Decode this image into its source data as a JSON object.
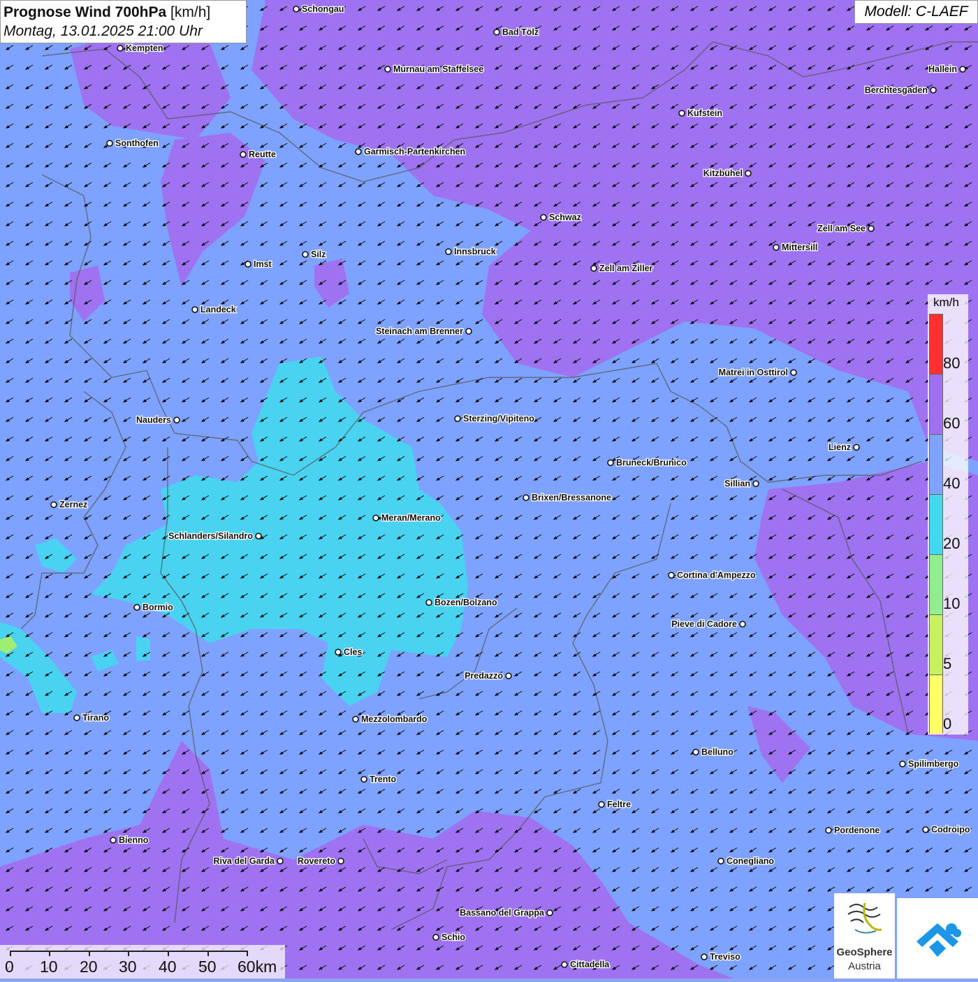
{
  "title": {
    "main": "Prognose Wind 700hPa",
    "unit": "[km/h]",
    "datetime": "Montag, 13.01.2025 21:00 Uhr"
  },
  "model_label": "Modell: C-LAEF",
  "colors": {
    "range_0_5": "#ffff66",
    "range_5_10": "#c8f060",
    "range_10_20": "#90ee90",
    "range_20_40": "#44d8f0",
    "range_40_60": "#7ea2ff",
    "range_60_80": "#a070f0",
    "range_80_plus": "#ff3030",
    "arrow": "#000000",
    "borders": "#555555"
  },
  "legend": {
    "unit": "km/h",
    "ticks": [
      "80",
      "60",
      "40",
      "20",
      "10",
      "5",
      "0"
    ]
  },
  "wind_arrows": {
    "direction": "from northeast toward southwest",
    "spacing_note": "uniform grid"
  },
  "scale_bar": {
    "labels": [
      "0",
      "10",
      "20",
      "30",
      "40",
      "50",
      "60km"
    ]
  },
  "cities": [
    {
      "name": "Schongau"
    },
    {
      "name": "Kempten"
    },
    {
      "name": "Bad Tölz"
    },
    {
      "name": "Murnau am Staffelsee"
    },
    {
      "name": "Hallein"
    },
    {
      "name": "Berchtesgaden"
    },
    {
      "name": "Kufstein"
    },
    {
      "name": "Sonthofen"
    },
    {
      "name": "Reutte"
    },
    {
      "name": "Garmisch-Partenkirchen"
    },
    {
      "name": "Kitzbühel"
    },
    {
      "name": "Schwaz"
    },
    {
      "name": "Zell am See"
    },
    {
      "name": "Mittersill"
    },
    {
      "name": "Innsbruck"
    },
    {
      "name": "Imst"
    },
    {
      "name": "Silz"
    },
    {
      "name": "Zell am Ziller"
    },
    {
      "name": "Landeck"
    },
    {
      "name": "Steinach am Brenner"
    },
    {
      "name": "Matrei in Osttirol"
    },
    {
      "name": "Nauders"
    },
    {
      "name": "Sterzing/Vipiteno"
    },
    {
      "name": "Lienz"
    },
    {
      "name": "Bruneck/Brunico"
    },
    {
      "name": "Sillian"
    },
    {
      "name": "Zernez"
    },
    {
      "name": "Brixen/Bressanone"
    },
    {
      "name": "Meran/Merano"
    },
    {
      "name": "Schlanders/Silandro"
    },
    {
      "name": "Cortina d'Ampezzo"
    },
    {
      "name": "Bozen/Bolzano"
    },
    {
      "name": "Bormio"
    },
    {
      "name": "Pieve di Cadore"
    },
    {
      "name": "Cles"
    },
    {
      "name": "Predazzo"
    },
    {
      "name": "Tirano"
    },
    {
      "name": "Mezzolombardo"
    },
    {
      "name": "Belluno"
    },
    {
      "name": "Spilimbergo"
    },
    {
      "name": "Trento"
    },
    {
      "name": "Feltre"
    },
    {
      "name": "Pordenone"
    },
    {
      "name": "Codroipo"
    },
    {
      "name": "Bienno"
    },
    {
      "name": "Riva del Garda"
    },
    {
      "name": "Rovereto"
    },
    {
      "name": "Conegliano"
    },
    {
      "name": "Bassano del Grappa"
    },
    {
      "name": "Schio"
    },
    {
      "name": "Treviso"
    },
    {
      "name": "Cittadella"
    }
  ],
  "logos": {
    "geosphere_line1": "GeoSphere",
    "geosphere_line2": "Austria"
  }
}
